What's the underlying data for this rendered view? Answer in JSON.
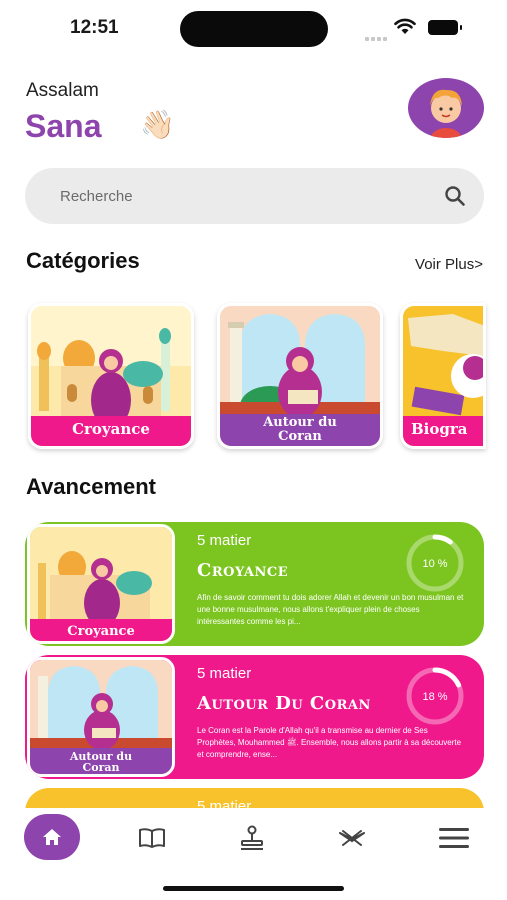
{
  "status": {
    "time": "12:51"
  },
  "header": {
    "greeting": "Assalam",
    "name": "Sana",
    "wave": "👋🏻"
  },
  "search": {
    "placeholder": "Recherche"
  },
  "categories": {
    "title": "Catégories",
    "see_more": "Voir Plus>",
    "items": [
      {
        "label": "Croyance",
        "color": "#f0198c"
      },
      {
        "label_line1": "Autour du",
        "label_line2": "Coran",
        "color": "#8e44ad"
      },
      {
        "label": "Biogra",
        "color": "#f0198c"
      }
    ]
  },
  "progress": {
    "title": "Avancement",
    "items": [
      {
        "count": "5 matier",
        "title": "Croyance",
        "description": "Afin de savoir comment tu dois adorer Allah et devenir un bon musulman et une bonne musulmane, nous allons t'expliquer plein de choses intéressantes comme les pi...",
        "percent_label": "10 %",
        "percent": 10,
        "color": "#7cc520",
        "thumb_label": "Croyance"
      },
      {
        "count": "5 matier",
        "title": "Autour Du Coran",
        "description": "Le Coran est la Parole d'Allah qu'il a transmise au dernier de Ses Prophètes, Mouhammed ﷺ. Ensemble, nous allons partir à sa découverte et comprendre, ense...",
        "percent_label": "18 %",
        "percent": 18,
        "color": "#f0198c",
        "thumb_label_line1": "Autour du",
        "thumb_label_line2": "Coran"
      },
      {
        "count": "5 matier",
        "color": "#f7c22b"
      }
    ]
  },
  "nav": {
    "items": [
      "home-icon",
      "book-icon",
      "stamp-icon",
      "quran-stand-icon",
      "menu-icon"
    ],
    "active_color": "#8e44ad"
  }
}
